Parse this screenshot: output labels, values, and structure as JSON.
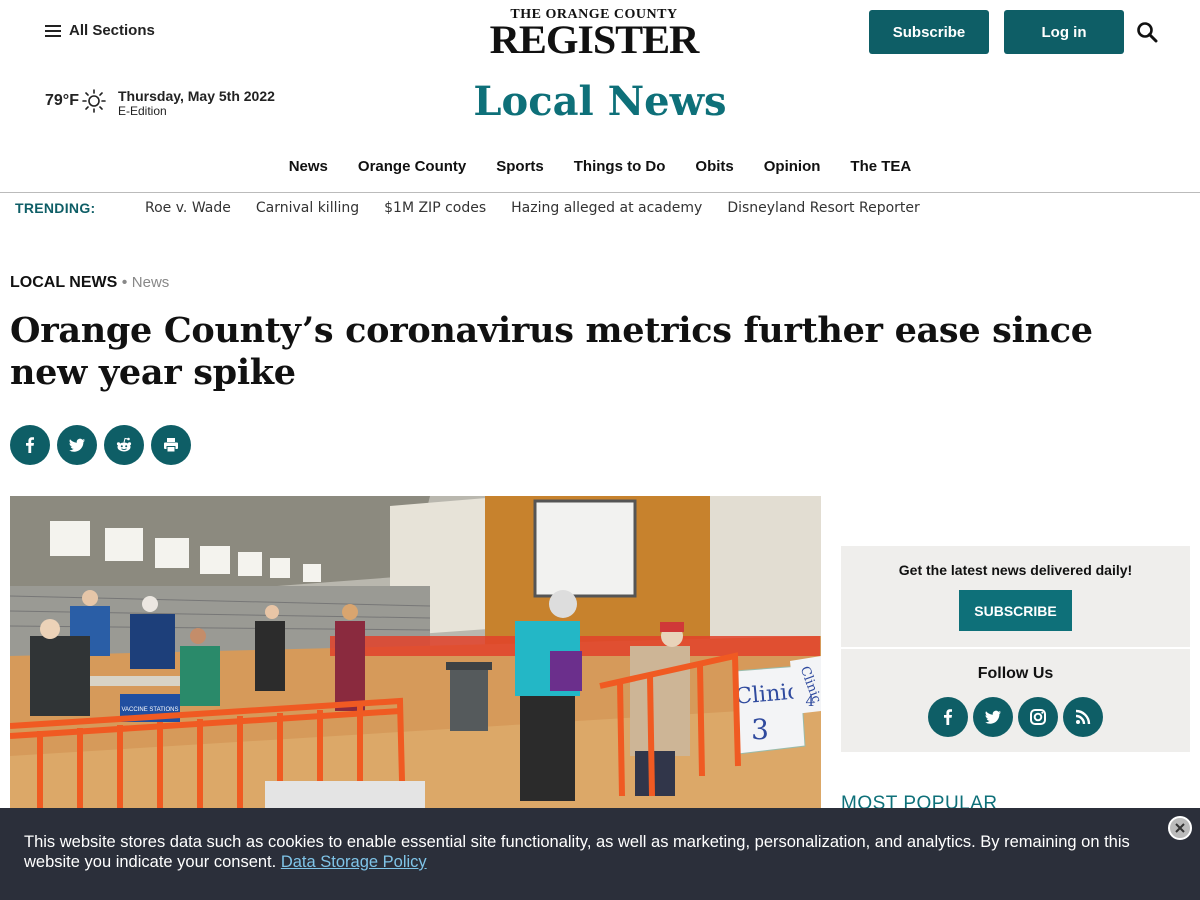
{
  "header": {
    "all_sections_label": "All Sections",
    "logo_top": "THE ORANGE COUNTY",
    "logo_main": "REGISTER",
    "subscribe_label": "Subscribe",
    "login_label": "Log in"
  },
  "weather": {
    "temperature": "79°F",
    "icon": "sun-icon"
  },
  "date": {
    "text": "Thursday, May 5th 2022",
    "edition": "E-Edition"
  },
  "section_title": "Local News",
  "nav": {
    "items": [
      {
        "label": "News"
      },
      {
        "label": "Orange County"
      },
      {
        "label": "Sports"
      },
      {
        "label": "Things to Do"
      },
      {
        "label": "Obits"
      },
      {
        "label": "Opinion"
      },
      {
        "label": "The TEA"
      }
    ]
  },
  "trending": {
    "label": "TRENDING:",
    "items": [
      {
        "label": "Roe v. Wade"
      },
      {
        "label": "Carnival killing"
      },
      {
        "label": "$1M ZIP codes"
      },
      {
        "label": "Hazing alleged at academy"
      },
      {
        "label": "Disneyland Resort Reporter"
      }
    ]
  },
  "article": {
    "kicker_main": "LOCAL NEWS",
    "kicker_sep": " • ",
    "kicker_sub": "News",
    "headline": "Orange County’s coronavirus metrics further ease since new year spike",
    "share_icons": [
      "facebook-icon",
      "twitter-icon",
      "reddit-icon",
      "print-icon"
    ]
  },
  "photo": {
    "sign_line1": "Clinic",
    "sign_line2": "3",
    "sign2_line1": "Clinic",
    "sign2_line2": "4",
    "banner_text": "VACCINE STATIONS"
  },
  "sidebar": {
    "newsletter_title": "Get the latest news delivered daily!",
    "newsletter_button": "SUBSCRIBE",
    "follow_title": "Follow Us",
    "follow_icons": [
      "facebook-icon",
      "twitter-icon",
      "instagram-icon",
      "rss-icon"
    ],
    "most_popular": "MOST POPULAR"
  },
  "cookie": {
    "text": "This website stores data such as cookies to enable essential site functionality, as well as marketing, personalization, and analytics. By remaining on this website you indicate your consent.",
    "link": "Data Storage Policy"
  },
  "colors": {
    "brand_teal": "#0e5e66",
    "title_teal": "#0e7079",
    "banner_bg": "#2b2f3a"
  }
}
